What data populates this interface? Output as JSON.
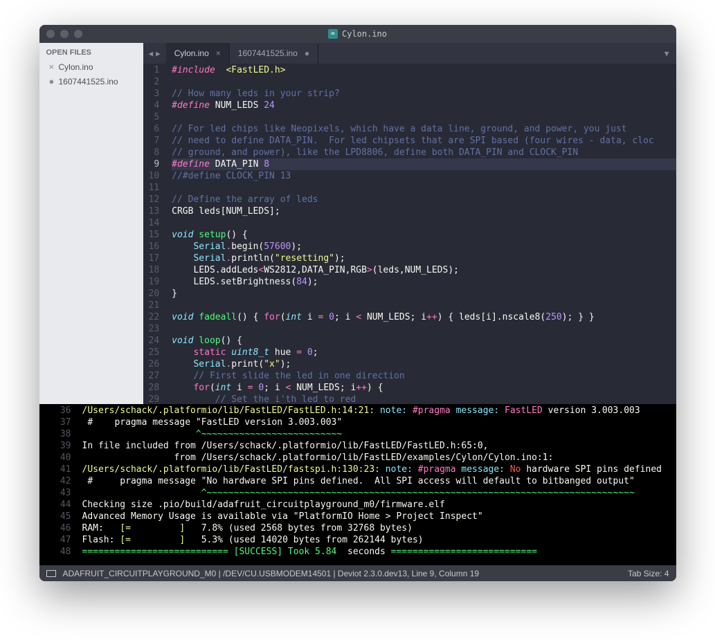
{
  "window": {
    "title": "Cylon.ino"
  },
  "sidebar": {
    "header": "OPEN FILES",
    "files": [
      {
        "marker": "×",
        "name": "Cylon.ino"
      },
      {
        "marker": "●",
        "name": "1607441525.ino"
      }
    ]
  },
  "tabs": [
    {
      "label": "Cylon.ino",
      "close": "×",
      "active": true
    },
    {
      "label": "1607441525.ino",
      "close": "●",
      "active": false
    }
  ],
  "nav": {
    "back": "◀",
    "fwd": "▶"
  },
  "menu_chevron": "▼",
  "code": {
    "lines": [
      {
        "n": 1,
        "hl": false,
        "tok": [
          [
            "inc",
            "#include"
          ],
          [
            "pl",
            "  "
          ],
          [
            "str",
            "<FastLED.h>"
          ]
        ]
      },
      {
        "n": 2,
        "hl": false,
        "tok": []
      },
      {
        "n": 3,
        "hl": false,
        "tok": [
          [
            "cm",
            "// How many leds in your strip?"
          ]
        ]
      },
      {
        "n": 4,
        "hl": false,
        "tok": [
          [
            "inc",
            "#define"
          ],
          [
            "pl",
            " "
          ],
          [
            "id",
            "NUM_LEDS"
          ],
          [
            "pl",
            " "
          ],
          [
            "num",
            "24"
          ]
        ]
      },
      {
        "n": 5,
        "hl": false,
        "tok": []
      },
      {
        "n": 6,
        "hl": false,
        "tok": [
          [
            "cm",
            "// For led chips like Neopixels, which have a data line, ground, and power, you just"
          ]
        ]
      },
      {
        "n": 7,
        "hl": false,
        "tok": [
          [
            "cm",
            "// need to define DATA_PIN.  For led chipsets that are SPI based (four wires - data, cloc"
          ]
        ]
      },
      {
        "n": 8,
        "hl": false,
        "tok": [
          [
            "cm",
            "// ground, and power), like the LPD8806, define both DATA_PIN and CLOCK_PIN"
          ]
        ]
      },
      {
        "n": 9,
        "hl": true,
        "tok": [
          [
            "inc",
            "#define"
          ],
          [
            "pl",
            " "
          ],
          [
            "id",
            "DATA_PIN"
          ],
          [
            "pl",
            " "
          ],
          [
            "num",
            "8"
          ]
        ]
      },
      {
        "n": 10,
        "hl": false,
        "tok": [
          [
            "cm",
            "//#define CLOCK_PIN 13"
          ]
        ]
      },
      {
        "n": 11,
        "hl": false,
        "tok": []
      },
      {
        "n": 12,
        "hl": false,
        "tok": [
          [
            "cm",
            "// Define the array of leds"
          ]
        ]
      },
      {
        "n": 13,
        "hl": false,
        "tok": [
          [
            "id",
            "CRGB leds[NUM_LEDS];"
          ]
        ]
      },
      {
        "n": 14,
        "hl": false,
        "tok": []
      },
      {
        "n": 15,
        "hl": false,
        "tok": [
          [
            "ty",
            "void"
          ],
          [
            "pl",
            " "
          ],
          [
            "fn",
            "setup"
          ],
          [
            "pl",
            "() {"
          ]
        ]
      },
      {
        "n": 16,
        "hl": false,
        "tok": [
          [
            "pl",
            "    "
          ],
          [
            "cls",
            "Serial"
          ],
          [
            "op",
            "."
          ],
          [
            "id",
            "begin("
          ],
          [
            "num",
            "57600"
          ],
          [
            "id",
            ");"
          ]
        ]
      },
      {
        "n": 17,
        "hl": false,
        "tok": [
          [
            "pl",
            "    "
          ],
          [
            "cls",
            "Serial"
          ],
          [
            "op",
            "."
          ],
          [
            "id",
            "println("
          ],
          [
            "str",
            "\"resetting\""
          ],
          [
            "id",
            ");"
          ]
        ]
      },
      {
        "n": 18,
        "hl": false,
        "tok": [
          [
            "pl",
            "    "
          ],
          [
            "id",
            "LEDS.addLeds"
          ],
          [
            "op",
            "<"
          ],
          [
            "id",
            "WS2812,DATA_PIN,RGB"
          ],
          [
            "op",
            ">"
          ],
          [
            "id",
            "(leds,NUM_LEDS);"
          ]
        ]
      },
      {
        "n": 19,
        "hl": false,
        "tok": [
          [
            "pl",
            "    "
          ],
          [
            "id",
            "LEDS.setBrightness("
          ],
          [
            "num",
            "84"
          ],
          [
            "id",
            ");"
          ]
        ]
      },
      {
        "n": 20,
        "hl": false,
        "tok": [
          [
            "pl",
            "}"
          ]
        ]
      },
      {
        "n": 21,
        "hl": false,
        "tok": []
      },
      {
        "n": 22,
        "hl": false,
        "tok": [
          [
            "ty",
            "void"
          ],
          [
            "pl",
            " "
          ],
          [
            "fn",
            "fadeall"
          ],
          [
            "pl",
            "() { "
          ],
          [
            "kw",
            "for"
          ],
          [
            "pl",
            "("
          ],
          [
            "ty",
            "int"
          ],
          [
            "pl",
            " i "
          ],
          [
            "op",
            "="
          ],
          [
            "pl",
            " "
          ],
          [
            "num",
            "0"
          ],
          [
            "pl",
            "; i "
          ],
          [
            "op",
            "<"
          ],
          [
            "pl",
            " NUM_LEDS; i"
          ],
          [
            "op",
            "++"
          ],
          [
            "pl",
            ") { leds[i].nscale8("
          ],
          [
            "num",
            "250"
          ],
          [
            "pl",
            "); } }"
          ]
        ]
      },
      {
        "n": 23,
        "hl": false,
        "tok": []
      },
      {
        "n": 24,
        "hl": false,
        "tok": [
          [
            "ty",
            "void"
          ],
          [
            "pl",
            " "
          ],
          [
            "fn",
            "loop"
          ],
          [
            "pl",
            "() {"
          ]
        ]
      },
      {
        "n": 25,
        "hl": false,
        "tok": [
          [
            "pl",
            "    "
          ],
          [
            "kw",
            "static"
          ],
          [
            "pl",
            " "
          ],
          [
            "ty",
            "uint8_t"
          ],
          [
            "pl",
            " hue "
          ],
          [
            "op",
            "="
          ],
          [
            "pl",
            " "
          ],
          [
            "num",
            "0"
          ],
          [
            "pl",
            ";"
          ]
        ]
      },
      {
        "n": 26,
        "hl": false,
        "tok": [
          [
            "pl",
            "    "
          ],
          [
            "cls",
            "Serial"
          ],
          [
            "op",
            "."
          ],
          [
            "id",
            "print("
          ],
          [
            "str",
            "\"x\""
          ],
          [
            "id",
            ");"
          ]
        ]
      },
      {
        "n": 27,
        "hl": false,
        "tok": [
          [
            "pl",
            "    "
          ],
          [
            "cm",
            "// First slide the led in one direction"
          ]
        ]
      },
      {
        "n": 28,
        "hl": false,
        "tok": [
          [
            "pl",
            "    "
          ],
          [
            "kw",
            "for"
          ],
          [
            "pl",
            "("
          ],
          [
            "ty",
            "int"
          ],
          [
            "pl",
            " i "
          ],
          [
            "op",
            "="
          ],
          [
            "pl",
            " "
          ],
          [
            "num",
            "0"
          ],
          [
            "pl",
            "; i "
          ],
          [
            "op",
            "<"
          ],
          [
            "pl",
            " NUM_LEDS; i"
          ],
          [
            "op",
            "++"
          ],
          [
            "pl",
            ") {"
          ]
        ]
      },
      {
        "n": 29,
        "hl": false,
        "tok": [
          [
            "pl",
            "        "
          ],
          [
            "cm",
            "// Set the i'th led to red"
          ]
        ]
      }
    ]
  },
  "console": {
    "lines": [
      {
        "n": 36,
        "tok": [
          [
            "cwarn",
            "/Users/schack/.platformio/lib/FastLED/FastLED.h:14:21: "
          ],
          [
            "cnote",
            "note: "
          ],
          [
            "cpp",
            "#pragma "
          ],
          [
            "cnote",
            "message: "
          ],
          [
            "cpp",
            "FastLED"
          ],
          [
            "pl",
            " version 3.003.003"
          ]
        ]
      },
      {
        "n": 37,
        "tok": [
          [
            "pl",
            " #    pragma message \"FastLED version 3.003.003\""
          ]
        ]
      },
      {
        "n": 38,
        "tok": [
          [
            "pl",
            "                     "
          ],
          [
            "csucc",
            "^~~~~~~~~~~~~~~~~~~~~~~~~~~"
          ]
        ]
      },
      {
        "n": 39,
        "tok": [
          [
            "pl",
            "In file included from /Users/schack/.platformio/lib/FastLED/FastLED.h:65:0,"
          ]
        ]
      },
      {
        "n": 40,
        "tok": [
          [
            "pl",
            "                 from /Users/schack/.platformio/lib/FastLED/examples/Cylon/Cylon.ino:1:"
          ]
        ]
      },
      {
        "n": 41,
        "tok": [
          [
            "cwarn",
            "/Users/schack/.platformio/lib/FastLED/fastspi.h:130:23: "
          ],
          [
            "cnote",
            "note: "
          ],
          [
            "cpp",
            "#pragma "
          ],
          [
            "cnote",
            "message: "
          ],
          [
            "cred",
            "No"
          ],
          [
            "pl",
            " hardware SPI pins defined"
          ]
        ]
      },
      {
        "n": 42,
        "tok": [
          [
            "pl",
            " #     pragma message \"No hardware SPI pins defined.  All SPI access will default to bitbanged output\""
          ]
        ]
      },
      {
        "n": 43,
        "tok": [
          [
            "pl",
            "                      "
          ],
          [
            "csucc",
            "^~~~~~~~~~~~~~~~~~~~~~~~~~~~~~~~~~~~~~~~~~~~~~~~~~~~~~~~~~~~~~~~~~~~~~~~~~~~~~~~"
          ]
        ]
      },
      {
        "n": 44,
        "tok": [
          [
            "pl",
            "Checking size .pio/build/adafruit_circuitplayground_m0/firmware.elf"
          ]
        ]
      },
      {
        "n": 45,
        "tok": [
          [
            "pl",
            "Advanced Memory Usage is available via \"PlatformIO Home > Project Inspect\""
          ]
        ]
      },
      {
        "n": 46,
        "tok": [
          [
            "pl",
            "RAM:   "
          ],
          [
            "cwarn",
            "[=         ]"
          ],
          [
            "pl",
            "   7.8% (used 2568 bytes from 32768 bytes)"
          ]
        ]
      },
      {
        "n": 47,
        "tok": [
          [
            "pl",
            "Flash: "
          ],
          [
            "cwarn",
            "[=         ]"
          ],
          [
            "pl",
            "   5.3% (used 14020 bytes from 262144 bytes)"
          ]
        ]
      },
      {
        "n": 48,
        "tok": [
          [
            "csucc",
            "=========================== "
          ],
          [
            "csucc",
            "[SUCCESS] Took 5.84 "
          ],
          [
            "pl",
            " seconds "
          ],
          [
            "csucc",
            "==========================="
          ]
        ]
      }
    ]
  },
  "statusbar": {
    "left": "ADAFRUIT_CIRCUITPLAYGROUND_M0 | /DEV/CU.USBMODEM14501 | Deviot 2.3.0.dev13, Line 9, Column 19",
    "right": "Tab Size: 4"
  }
}
